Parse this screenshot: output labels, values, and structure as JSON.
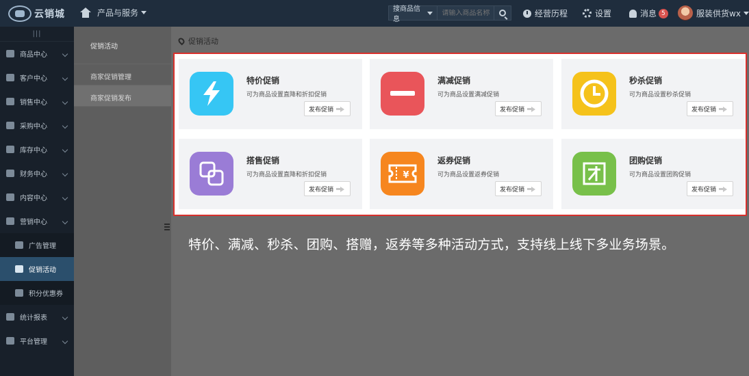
{
  "colors": {
    "topbar": "#1f2d3d",
    "sidebar": "#18202a",
    "highlight_border": "#d9302c",
    "tile_flash": "#36c6f4",
    "tile_minus": "#e9555a",
    "tile_clock": "#f5c21b",
    "tile_bundle": "#9a7cd6",
    "tile_coupon": "#f6861f",
    "tile_group": "#78c04a"
  },
  "header": {
    "logo_text": "云销城",
    "nav_label": "产品与服务",
    "search": {
      "category": "搜商品信息",
      "placeholder": "请输入商品名称"
    },
    "history_label": "经营历程",
    "settings_label": "设置",
    "messages_label": "消息",
    "messages_count": "5",
    "user_name": "服装供货wx"
  },
  "sidebar": {
    "toggle": "|||",
    "items": [
      {
        "label": "商品中心",
        "icon": "bag-icon"
      },
      {
        "label": "客户中心",
        "icon": "user-icon"
      },
      {
        "label": "销售中心",
        "icon": "cart-icon"
      },
      {
        "label": "采购中心",
        "icon": "basket-icon"
      },
      {
        "label": "库存中心",
        "icon": "box-icon"
      },
      {
        "label": "财务中心",
        "icon": "yuan-icon"
      },
      {
        "label": "内容中心",
        "icon": "content-icon"
      },
      {
        "label": "营销中心",
        "icon": "tag-icon"
      }
    ],
    "sub_items": [
      {
        "label": "广告管理",
        "icon": "megaphone-icon"
      },
      {
        "label": "促销活动",
        "icon": "promo-icon"
      },
      {
        "label": "积分优惠券",
        "icon": "coupon-icon"
      }
    ],
    "bottom_items": [
      {
        "label": "统计报表",
        "icon": "chart-icon"
      },
      {
        "label": "平台管理",
        "icon": "monitor-icon"
      }
    ]
  },
  "subnav": {
    "title": "促销活动",
    "items": [
      "商家促销管理",
      "商家促销发布"
    ]
  },
  "breadcrumb": "促销活动",
  "promos": [
    {
      "title": "特价促销",
      "desc": "可为商品设置直降和折扣促销",
      "button": "发布促销",
      "icon": "lightning-icon"
    },
    {
      "title": "满减促销",
      "desc": "可为商品设置满减促销",
      "button": "发布促销",
      "icon": "minus-icon"
    },
    {
      "title": "秒杀促销",
      "desc": "可为商品设置秒杀促销",
      "button": "发布促销",
      "icon": "clock-icon"
    },
    {
      "title": "搭售促销",
      "desc": "可为商品设置直降和折扣促销",
      "button": "发布促销",
      "icon": "bundle-icon"
    },
    {
      "title": "返券促销",
      "desc": "可为商品设置返券促销",
      "button": "发布促销",
      "icon": "coupon-yuan-icon"
    },
    {
      "title": "团购促销",
      "desc": "可为商品设置团购促销",
      "button": "发布促销",
      "icon": "group-icon"
    }
  ],
  "caption": "特价、满减、秒杀、团购、搭赠，返券等多种活动方式，支持线上线下多业务场景。"
}
